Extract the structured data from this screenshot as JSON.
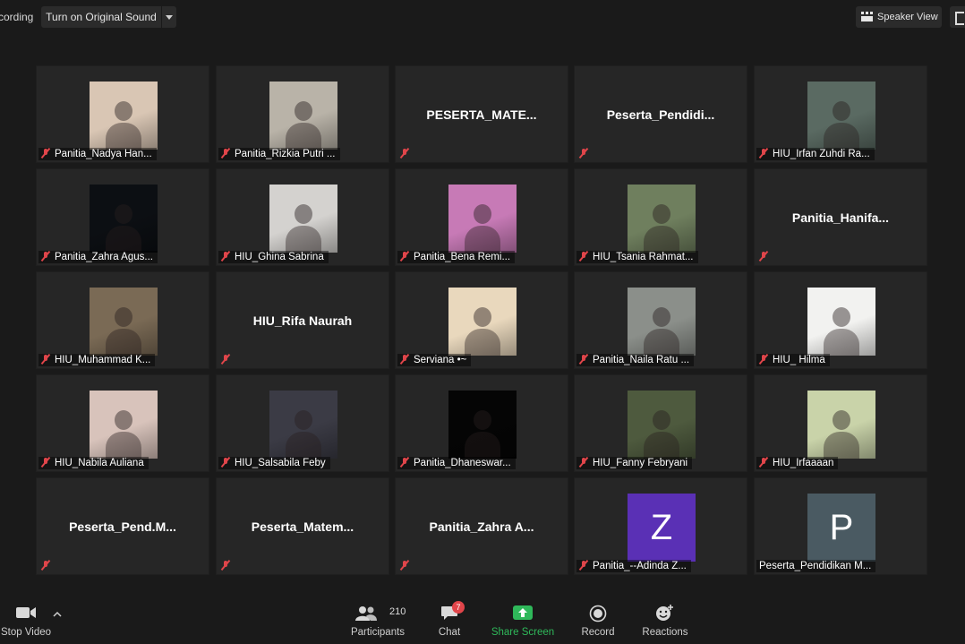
{
  "topbar": {
    "recording_label": "cording",
    "original_sound_label": "Turn on Original Sound",
    "speaker_view_label": "Speaker View"
  },
  "tiles": [
    {
      "name": "Panitia_Nadya Han...",
      "display": "video",
      "photo_color": "#d9c6b4"
    },
    {
      "name": "Panitia_Rizkia Putri ...",
      "display": "video",
      "photo_color": "#b9b3a8"
    },
    {
      "name": "",
      "display": "name",
      "big_name": "PESERTA_MATE..."
    },
    {
      "name": "",
      "display": "name",
      "big_name": "Peserta_Pendidi..."
    },
    {
      "name": "HIU_Irfan Zuhdi Ra...",
      "display": "video",
      "photo_color": "#5a6a62"
    },
    {
      "name": "Panitia_Zahra Agus...",
      "display": "video",
      "photo_color": "#0c0f13"
    },
    {
      "name": "HIU_Ghina Sabrina",
      "display": "video",
      "photo_color": "#d4d2cf"
    },
    {
      "name": "Panitia_Bena Remi...",
      "display": "video",
      "photo_color": "#c77ab6"
    },
    {
      "name": "HIU_Tsania Rahmat...",
      "display": "video",
      "photo_color": "#6f7f5e"
    },
    {
      "name": "",
      "display": "name",
      "big_name": "Panitia_Hanifa..."
    },
    {
      "name": "HIU_Muhammad K...",
      "display": "video",
      "photo_color": "#7a6a55"
    },
    {
      "name": "",
      "display": "name",
      "big_name": "HIU_Rifa Naurah"
    },
    {
      "name": "Serviana •~",
      "display": "video",
      "photo_color": "#e9d8bd"
    },
    {
      "name": "Panitia_Naila Ratu ...",
      "display": "video",
      "photo_color": "#8b8f8a"
    },
    {
      "name": "HIU_ Hilma",
      "display": "video",
      "photo_color": "#f2f2f0"
    },
    {
      "name": "HIU_Nabila Auliana",
      "display": "video",
      "photo_color": "#d8c3bb"
    },
    {
      "name": "HIU_Salsabila Feby",
      "display": "video",
      "photo_color": "#3b3b45"
    },
    {
      "name": "Panitia_Dhaneswar...",
      "display": "video",
      "photo_color": "#050505"
    },
    {
      "name": "HIU_Fanny Febryani",
      "display": "video",
      "photo_color": "#4e5a3e"
    },
    {
      "name": "HIU_Irfaaaan",
      "display": "video",
      "photo_color": "#c9d3a9"
    },
    {
      "name": "",
      "display": "name",
      "big_name": "Peserta_Pend.M..."
    },
    {
      "name": "",
      "display": "name",
      "big_name": "Peserta_Matem..."
    },
    {
      "name": "",
      "display": "name",
      "big_name": "Panitia_Zahra  A..."
    },
    {
      "name": "Panitia_--Adinda Z...",
      "display": "letter",
      "letter": "Z",
      "photo_color": "#5a30b5"
    },
    {
      "name": "Peserta_Pendidikan M...",
      "display": "letter",
      "letter": "P",
      "photo_color": "#4a5a62",
      "muted": false
    }
  ],
  "toolbar": {
    "stop_video": "Stop Video",
    "participants_label": "Participants",
    "participants_count": "210",
    "chat_label": "Chat",
    "chat_badge": "7",
    "share_label": "Share Screen",
    "record_label": "Record",
    "reactions_label": "Reactions"
  },
  "colors": {
    "mute": "#e0454a",
    "share": "#2fb85a",
    "background": "#1a1a1a",
    "tile": "#262626"
  }
}
